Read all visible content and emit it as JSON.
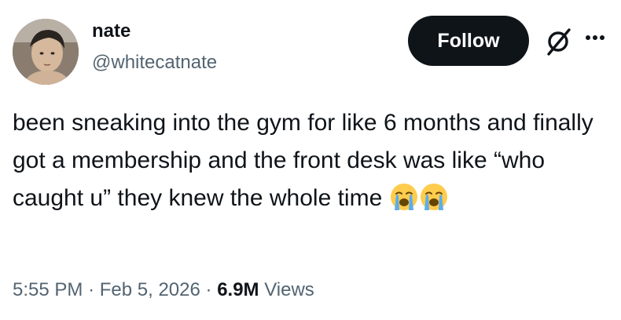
{
  "user": {
    "display_name": "nate",
    "handle": "@whitecatnate"
  },
  "actions": {
    "follow_label": "Follow",
    "grok_icon": "slashed-circle-icon",
    "more_icon": "more-horizontal-icon"
  },
  "tweet": {
    "text": "been sneaking into the gym for like 6 months and finally got a membership and the front desk was like “who caught u” they knew the whole time",
    "emojis": [
      "loudly-crying-face",
      "loudly-crying-face"
    ]
  },
  "meta": {
    "time": "5:55 PM",
    "separator": "·",
    "date": "Feb 5, 2026",
    "views_count": "6.9M",
    "views_label": "Views"
  },
  "colors": {
    "text_primary": "#0f1419",
    "text_secondary": "#536471",
    "button_bg": "#0f1419",
    "button_text": "#ffffff"
  }
}
